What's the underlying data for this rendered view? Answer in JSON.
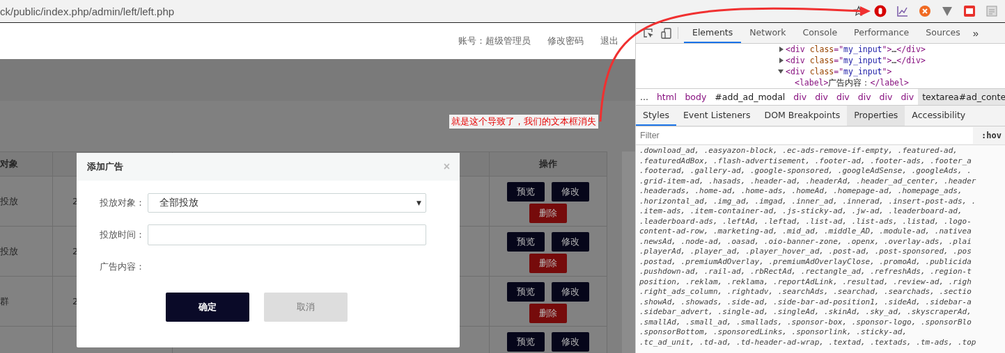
{
  "browser": {
    "url": "ck/public/index.php/admin/left/left.php"
  },
  "page": {
    "header": {
      "account": "账号：超级管理员",
      "links": [
        "修改密码",
        "退出"
      ]
    },
    "table": {
      "columns": [
        {
          "label": "对象"
        },
        {
          "label": "操作"
        }
      ],
      "rows": [
        {
          "column_1": "投放",
          "column_2": "2",
          "actions": [
            {
              "label": "预览",
              "kind": "dark"
            },
            {
              "label": "修改",
              "kind": "dark"
            },
            {
              "label": "删除",
              "kind": "danger"
            }
          ]
        },
        {
          "column_1": "投放",
          "column_2": "2",
          "actions": [
            {
              "label": "预览",
              "kind": "dark"
            },
            {
              "label": "修改",
              "kind": "dark"
            },
            {
              "label": "删除",
              "kind": "danger"
            }
          ]
        },
        {
          "column_1": "群",
          "column_2": "2",
          "actions": [
            {
              "label": "预览",
              "kind": "dark"
            },
            {
              "label": "修改",
              "kind": "dark"
            },
            {
              "label": "删除",
              "kind": "danger"
            }
          ]
        },
        {
          "actions": [
            {
              "label": "预览",
              "kind": "dark"
            },
            {
              "label": "修改",
              "kind": "dark"
            }
          ]
        }
      ]
    },
    "modal": {
      "title": "添加广告",
      "close": "×",
      "fields": [
        {
          "kind": "select",
          "label": "投放对象：",
          "value": "全部投放",
          "caret": "▼"
        },
        {
          "kind": "input",
          "label": "投放时间："
        },
        {
          "kind": "text",
          "label": "广告内容："
        }
      ],
      "buttons": [
        {
          "label": "确定",
          "kind": "primary"
        },
        {
          "label": "取消",
          "kind": "secondary"
        }
      ]
    }
  },
  "annotation": {
    "text": "就是这个导致了，我们的文本框消失"
  },
  "devtools": {
    "tabs": [
      {
        "label": "Elements",
        "selected": true
      },
      {
        "label": "Network",
        "selected": false
      },
      {
        "label": "Console",
        "selected": false
      },
      {
        "label": "Performance",
        "selected": false
      },
      {
        "label": "Sources",
        "selected": false
      }
    ],
    "more": "»",
    "dom": [
      {
        "expanded": false,
        "segments": [
          {
            "kind": "tag",
            "t": "<div"
          },
          {
            "kind": "attr",
            "t": " class"
          },
          {
            "kind": "tag",
            "t": "=\""
          },
          {
            "kind": "value",
            "t": "my_input"
          },
          {
            "kind": "tag",
            "t": "\">"
          },
          {
            "kind": "plain",
            "t": "…"
          },
          {
            "kind": "tag",
            "t": "</div>"
          }
        ]
      },
      {
        "expanded": false,
        "segments": [
          {
            "kind": "tag",
            "t": "<div"
          },
          {
            "kind": "attr",
            "t": " class"
          },
          {
            "kind": "tag",
            "t": "=\""
          },
          {
            "kind": "value",
            "t": "my_input"
          },
          {
            "kind": "tag",
            "t": "\">"
          },
          {
            "kind": "plain",
            "t": "…"
          },
          {
            "kind": "tag",
            "t": "</div>"
          }
        ]
      },
      {
        "expanded": true,
        "segments": [
          {
            "kind": "tag",
            "t": "<div"
          },
          {
            "kind": "attr",
            "t": " class"
          },
          {
            "kind": "tag",
            "t": "=\""
          },
          {
            "kind": "value",
            "t": "my_input"
          },
          {
            "kind": "tag",
            "t": "\">"
          }
        ],
        "children": [
          {
            "segments": [
              {
                "kind": "tag",
                "t": "<label>"
              },
              {
                "kind": "plain",
                "t": "广告内容："
              },
              {
                "kind": "tag",
                "t": "</label>"
              }
            ]
          }
        ]
      }
    ],
    "breadcrumb": [
      {
        "label": "...",
        "kind": "plain",
        "selected": false
      },
      {
        "label": "html",
        "kind": "tag",
        "selected": false
      },
      {
        "label": "body",
        "kind": "tag",
        "selected": false
      },
      {
        "label": "#add_ad_modal",
        "kind": "plain",
        "selected": false
      },
      {
        "label": "div",
        "kind": "tag",
        "selected": false
      },
      {
        "label": "div",
        "kind": "tag",
        "selected": false
      },
      {
        "label": "div",
        "kind": "tag",
        "selected": false
      },
      {
        "label": "div",
        "kind": "tag",
        "selected": false
      },
      {
        "label": "div",
        "kind": "tag",
        "selected": false
      },
      {
        "label": "div",
        "kind": "tag",
        "selected": false
      },
      {
        "label": "textarea#ad_conte",
        "kind": "plain",
        "selected": true
      }
    ],
    "subtabs": [
      {
        "label": "Styles",
        "selected": true,
        "hovered": false
      },
      {
        "label": "Event Listeners",
        "selected": false,
        "hovered": false
      },
      {
        "label": "DOM Breakpoints",
        "selected": false,
        "hovered": false
      },
      {
        "label": "Properties",
        "selected": false,
        "hovered": true
      },
      {
        "label": "Accessibility",
        "selected": false,
        "hovered": false
      }
    ],
    "filter": {
      "placeholder": "Filter"
    },
    "hov": ":hov",
    "css_lines": [
      ".download_ad, .easyazon-block, .ec-ads-remove-if-empty, .featured-ad,",
      ".featuredAdBox, .flash-advertisement, .footer-ad, .footer-ads, .footer_a",
      ".footerad, .gallery-ad, .google-sponsored, .googleAdSense, .googleAds, .",
      ".grid-item-ad, .hasads, .header-ad, .headerAd, .header_ad_center, .header",
      ".headerads, .home-ad, .home-ads, .homeAd, .homepage-ad, .homepage_ads,",
      ".horizontal_ad, .img_ad, .imgad, .inner_ad, .innerad, .insert-post-ads, .",
      ".item-ads, .item-container-ad, .js-sticky-ad, .jw-ad, .leaderboard-ad,",
      ".leaderboard-ads, .leftAd, .leftad, .list-ad, .list-ads, .listad, .logo-",
      "content-ad-row, .marketing-ad, .mid_ad, .middle_AD, .module-ad, .nativea",
      ".newsAd, .node-ad, .oasad, .oio-banner-zone, .openx, .overlay-ads, .plai",
      ".playerAd, .player_ad, .player_hover_ad, .post-ad, .post-sponsored, .pos",
      ".postad, .premiumAdOverlay, .premiumAdOverlayClose, .promoAd, .publicida",
      ".pushdown-ad, .rail-ad, .rbRectAd, .rectangle_ad, .refreshAds, .region-t",
      "position, .reklam, .reklama, .reportAdLink, .resultad, .review-ad, .righ",
      ".right_ads_column, .rightadv, .searchAds, .searchad, .searchads, .sectio",
      ".showAd, .showads, .side-ad, .side-bar-ad-position1, .sideAd, .sidebar-a",
      ".sidebar_advert, .single-ad, .singleAd, .skinAd, .sky_ad, .skyscraperAd,",
      ".smallAd, .small_ad, .smallads, .sponsor-box, .sponsor-logo, .sponsorBlo",
      ".sponsorBottom, .sponsoredLinks, .sponsorlink, .sticky-ad,",
      ".tc_ad_unit, .td-ad, .td-header-ad-wrap, .textad, .textads, .tm-ads, .top"
    ]
  }
}
